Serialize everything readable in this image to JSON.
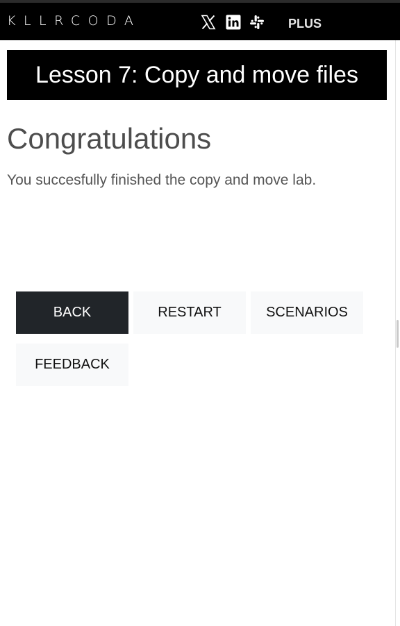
{
  "nav": {
    "logo_text": "KLLRCODA",
    "social_icons": [
      "x-icon",
      "linkedin-icon",
      "slack-icon"
    ],
    "plus_label": "PLUS"
  },
  "lesson": {
    "title": "Lesson 7: Copy and move files"
  },
  "content": {
    "heading": "Congratulations",
    "message": "You succesfully finished the copy and move lab."
  },
  "actions": {
    "back": "BACK",
    "restart": "RESTART",
    "scenarios": "SCENARIOS",
    "feedback": "FEEDBACK"
  },
  "colors": {
    "nav_bg": "#000000",
    "title_bg": "#000000",
    "primary_button": "#212529",
    "secondary_button": "#f8f9fa",
    "heading_text": "#4d4d4d"
  }
}
